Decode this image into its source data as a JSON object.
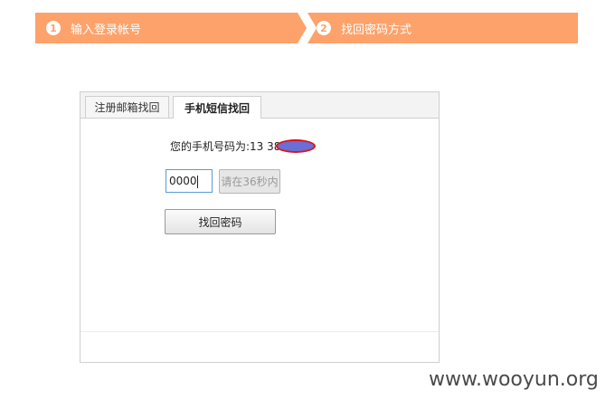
{
  "steps": [
    {
      "number": "1",
      "label": "输入登录帐号"
    },
    {
      "number": "2",
      "label": "找回密码方式"
    }
  ],
  "tabs": [
    {
      "label": "注册邮箱找回"
    },
    {
      "label": "手机短信找回"
    }
  ],
  "form": {
    "phone_text": "您的手机号码为:13          382",
    "code_value": "0000",
    "countdown_label": "请在36秒内",
    "submit_label": "找回密码"
  },
  "watermark": "www.wooyun.org",
  "colors": {
    "step_bar": "#fda26b",
    "redaction_fill": "#6b6ed4",
    "redaction_outline": "#d8141c"
  }
}
